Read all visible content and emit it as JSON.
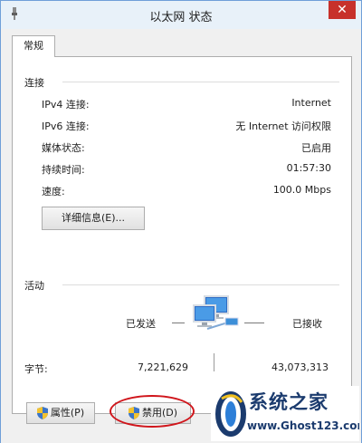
{
  "window": {
    "title": "以太网 状态",
    "close_icon": "close-icon"
  },
  "tabs": [
    {
      "label": "常规",
      "selected": true
    }
  ],
  "connection": {
    "group_label": "连接",
    "rows": [
      {
        "label": "IPv4 连接:",
        "value": "Internet"
      },
      {
        "label": "IPv6 连接:",
        "value": "无 Internet 访问权限"
      },
      {
        "label": "媒体状态:",
        "value": "已启用"
      },
      {
        "label": "持续时间:",
        "value": "01:57:30"
      },
      {
        "label": "速度:",
        "value": "100.0 Mbps"
      }
    ],
    "details_button": "详细信息(E)..."
  },
  "activity": {
    "group_label": "活动",
    "sent_label": "已发送",
    "received_label": "已接收",
    "bytes_label": "字节:",
    "bytes_sent": "7,221,629",
    "bytes_received": "43,073,313",
    "icon": "network-computers-icon"
  },
  "buttons": {
    "properties": "属性(P)",
    "disable": "禁用(D)"
  },
  "annotation": {
    "color": "#d0151b"
  },
  "watermark": {
    "name": "系统之家",
    "url": "www.Ghost123.com"
  },
  "colors": {
    "title_bar": "#e8f1f9",
    "close_button": "#c7312b",
    "watermark_text": "#1b3b6e"
  }
}
